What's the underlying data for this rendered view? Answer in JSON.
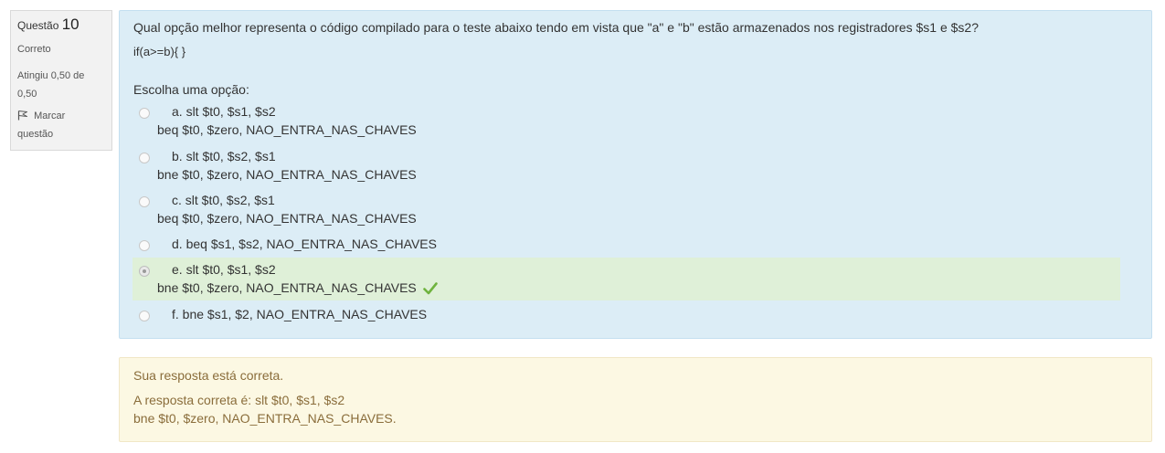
{
  "info": {
    "question_label": "Questão",
    "question_number": "10",
    "state": "Correto",
    "grade_line1": "Atingiu 0,50 de",
    "grade_line2": "0,50",
    "flag_line1": "Marcar",
    "flag_line2": "questão",
    "flag_icon": "flag-icon"
  },
  "question": {
    "text": "Qual opção melhor representa o código compilado para o teste abaixo tendo em vista que \"a\" e \"b\" estão armazenados nos registradores $s1 e $s2?",
    "code": "if(a>=b){ }",
    "prompt": "Escolha uma opção:"
  },
  "options": [
    {
      "line1": "a. slt $t0, $s1, $s2",
      "line2": "beq $t0, $zero, NAO_ENTRA_NAS_CHAVES"
    },
    {
      "line1": "b. slt $t0, $s2, $s1",
      "line2": "bne $t0, $zero, NAO_ENTRA_NAS_CHAVES"
    },
    {
      "line1": "c. slt $t0, $s2, $s1",
      "line2": "beq $t0, $zero, NAO_ENTRA_NAS_CHAVES"
    },
    {
      "line1": "d. beq $s1, $s2, NAO_ENTRA_NAS_CHAVES"
    },
    {
      "line1": "e. slt $t0, $s1, $s2",
      "line2": "bne $t0, $zero, NAO_ENTRA_NAS_CHAVES",
      "selected": true,
      "correct": true
    },
    {
      "line1": "f. bne $s1, $2, NAO_ENTRA_NAS_CHAVES"
    }
  ],
  "feedback": {
    "status": "Sua resposta está correta.",
    "answer_line1": "A resposta correta é: slt $t0, $s1, $s2",
    "answer_line2": "bne $t0, $zero, NAO_ENTRA_NAS_CHAVES."
  },
  "colors": {
    "formulation_bg": "#dcedf6",
    "correct_bg": "#dff0d8",
    "feedback_bg": "#fcf8e3",
    "check": "#6fb33e"
  }
}
